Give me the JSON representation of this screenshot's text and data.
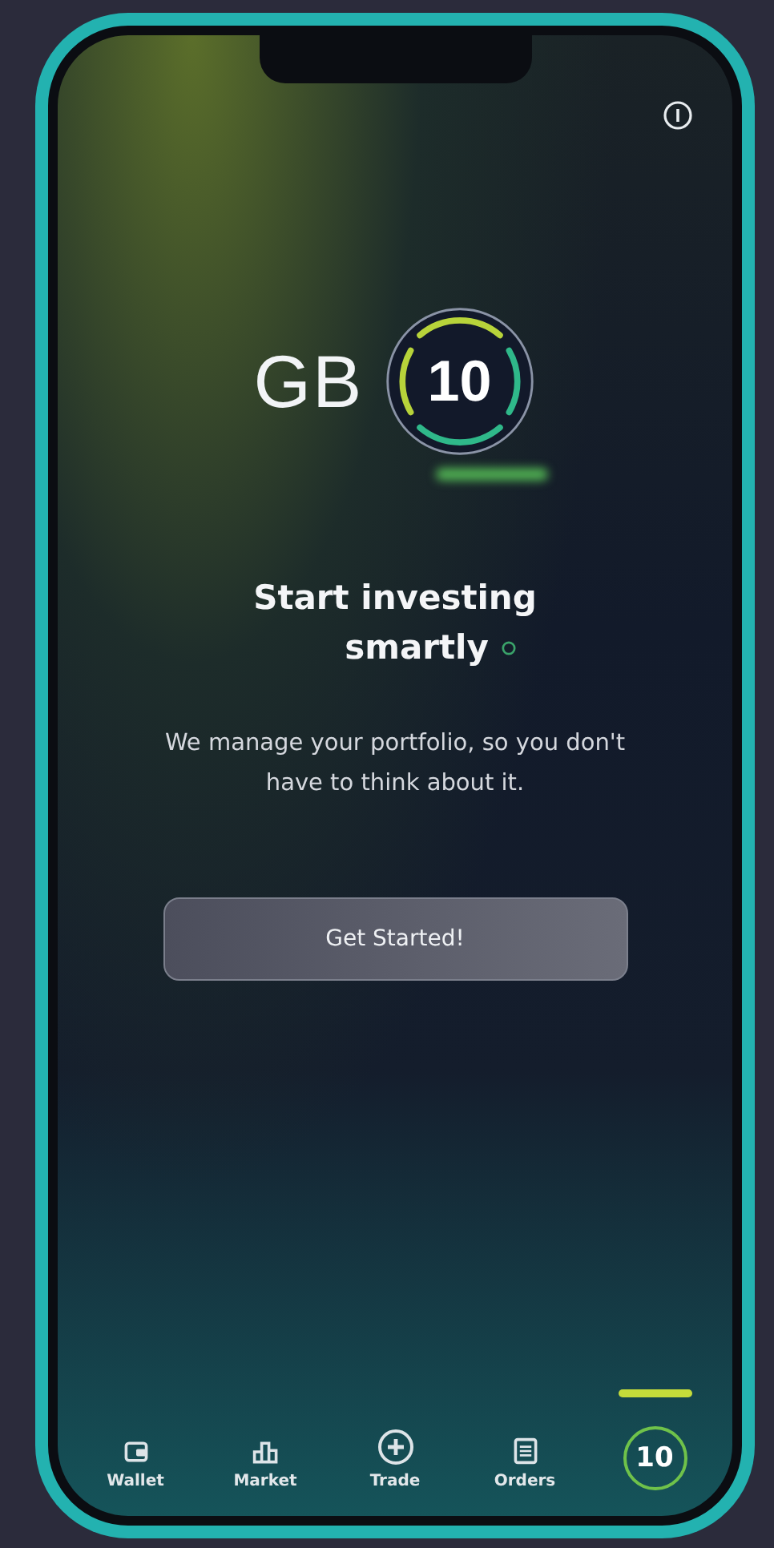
{
  "logo": {
    "letters": "GB",
    "badge": "10"
  },
  "headline": [
    "Start investing",
    "smartly"
  ],
  "description": "We manage your portfolio,  so you don't have to think about it.",
  "button": "Get Started!",
  "nav": [
    {
      "kind": "wallet",
      "label": "Wallet",
      "selected": false
    },
    {
      "kind": "market",
      "label": "Market",
      "selected": false
    },
    {
      "kind": "trade",
      "label": "Trade",
      "selected": false
    },
    {
      "kind": "orders",
      "label": "Orders",
      "selected": false
    },
    {
      "kind": "logo",
      "label": "10",
      "selected": true
    }
  ]
}
